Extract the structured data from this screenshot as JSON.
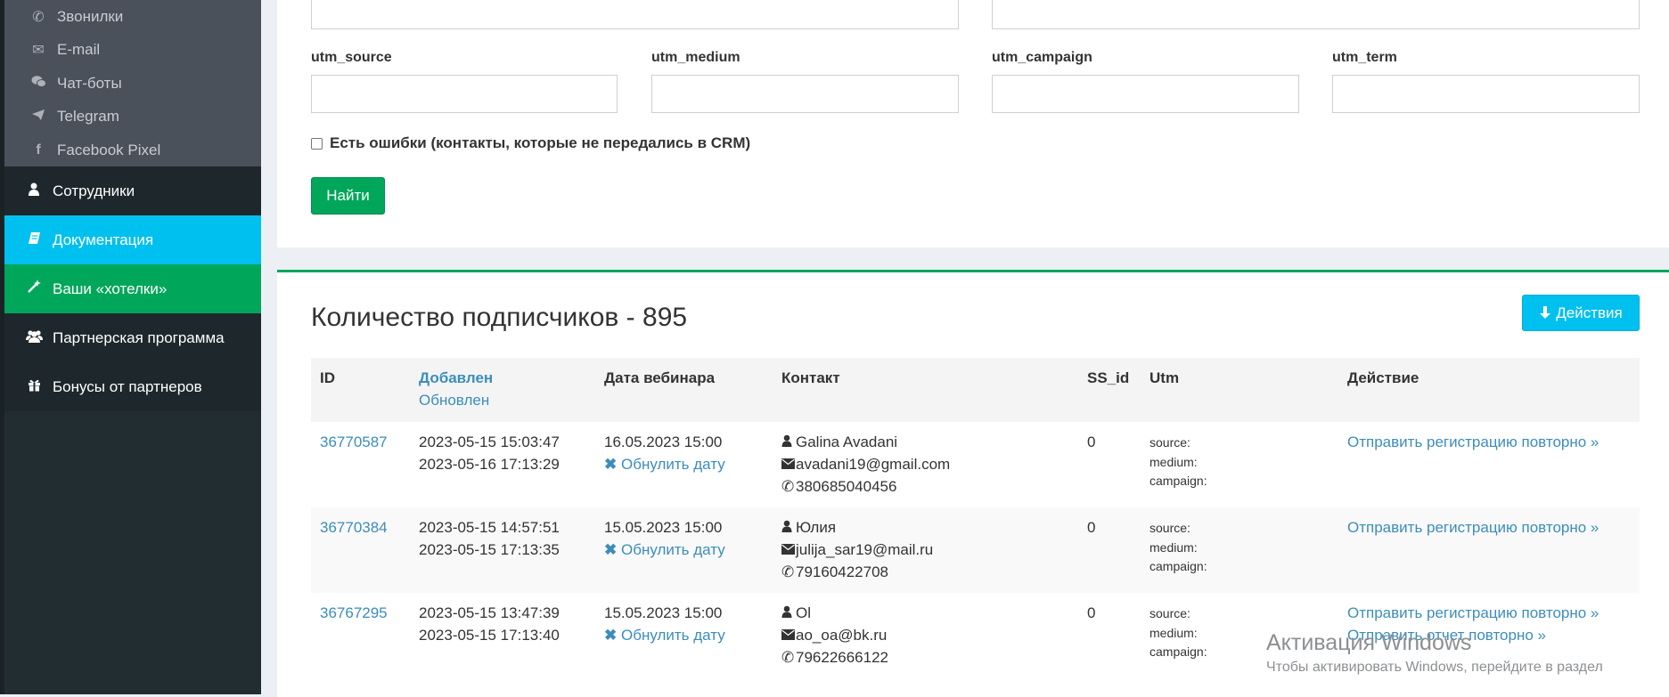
{
  "sidebar": {
    "submenu": [
      {
        "icon": "phone-icon",
        "label": "Звонилки"
      },
      {
        "icon": "envelope-icon",
        "label": "E-mail"
      },
      {
        "icon": "chat-icon",
        "label": "Чат-боты"
      },
      {
        "icon": "telegram-icon",
        "label": "Telegram"
      },
      {
        "icon": "facebook-icon",
        "label": "Facebook Pixel"
      }
    ],
    "menu": [
      {
        "icon": "user-icon",
        "label": "Сотрудники",
        "color": "#1e282c"
      },
      {
        "icon": "book-icon",
        "label": "Документация",
        "color": "#00c0ef"
      },
      {
        "icon": "magic-wand-icon",
        "label": "Ваши «хотелки»",
        "color": "#00a65a"
      },
      {
        "icon": "users-icon",
        "label": "Партнерская программа",
        "color": "#1e282c"
      },
      {
        "icon": "gift-icon",
        "label": "Бонусы от партнеров",
        "color": "#1e282c"
      }
    ]
  },
  "filters": {
    "utm_source_label": "utm_source",
    "utm_medium_label": "utm_medium",
    "utm_campaign_label": "utm_campaign",
    "utm_term_label": "utm_term",
    "utm_source_value": "",
    "utm_medium_value": "",
    "utm_campaign_value": "",
    "utm_term_value": "",
    "errors_checkbox_label": "Есть ошибки (контакты, которые не передались в CRM)",
    "errors_checked": false,
    "find_button": "Найти"
  },
  "subscribers": {
    "title": "Количество подписчиков - 895",
    "actions_button": "Действия",
    "columns": {
      "id": "ID",
      "added": "Добавлен",
      "updated": "Обновлен",
      "webinar_date": "Дата вебинара",
      "contact": "Контакт",
      "ss_id": "SS_id",
      "utm": "Utm",
      "action": "Действие"
    },
    "utm_labels": {
      "source": "source:",
      "medium": "medium:",
      "campaign": "campaign:"
    },
    "reset_date_label": "Обнулить дату",
    "rows": [
      {
        "id": "36770587",
        "added": "2023-05-15 15:03:47",
        "updated": "2023-05-16 17:13:29",
        "webinar_date": "16.05.2023 15:00",
        "name": "Galina Avadani",
        "email": "avadani19@gmail.com",
        "phone": "380685040456",
        "ss_id": "0",
        "actions": [
          "Отправить регистрацию повторно »"
        ]
      },
      {
        "id": "36770384",
        "added": "2023-05-15 14:57:51",
        "updated": "2023-05-15 17:13:35",
        "webinar_date": "15.05.2023 15:00",
        "name": "Юлия",
        "email": "julija_sar19@mail.ru",
        "phone": "79160422708",
        "ss_id": "0",
        "actions": [
          "Отправить регистрацию повторно »"
        ]
      },
      {
        "id": "36767295",
        "added": "2023-05-15 13:47:39",
        "updated": "2023-05-15 17:13:40",
        "webinar_date": "15.05.2023 15:00",
        "name": "Ol",
        "email": "ao_oa@bk.ru",
        "phone": "79622666122",
        "ss_id": "0",
        "actions": [
          "Отправить регистрацию повторно »",
          "Отправить отчет повторно »"
        ]
      }
    ]
  },
  "watermark": {
    "title": "Активация Windows",
    "subtitle": "Чтобы активировать Windows, перейдите в раздел"
  }
}
